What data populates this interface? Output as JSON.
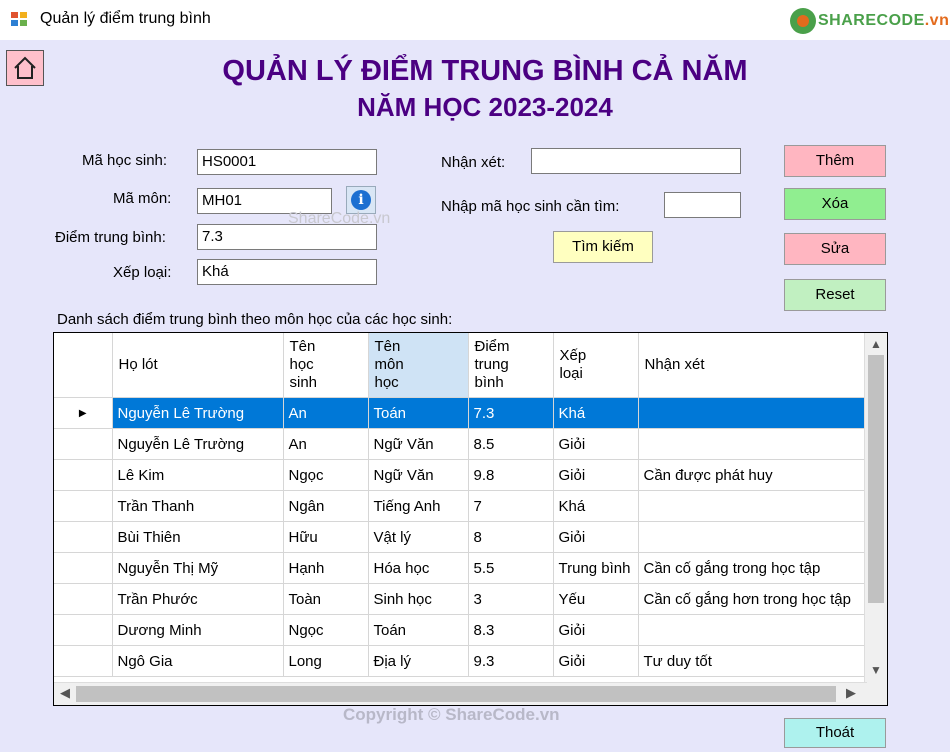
{
  "window": {
    "title": "Quản lý điểm trung bình",
    "brand": "SHARECODE",
    "brand_suffix": ".vn"
  },
  "header": {
    "title": "QUẢN LÝ ĐIỂM TRUNG BÌNH CẢ NĂM",
    "subtitle": "NĂM HỌC 2023-2024"
  },
  "form": {
    "ma_hoc_sinh_label": "Mã học sinh:",
    "ma_hoc_sinh_value": "HS0001",
    "ma_mon_label": "Mã môn:",
    "ma_mon_value": "MH01",
    "diem_tb_label": "Điểm trung bình:",
    "diem_tb_value": "7.3",
    "xep_loai_label": "Xếp loại:",
    "xep_loai_value": "Khá",
    "nhan_xet_label": "Nhận xét:",
    "nhan_xet_value": "",
    "search_label": "Nhập mã học sinh cần tìm:",
    "search_value": ""
  },
  "buttons": {
    "search": "Tìm kiếm",
    "add": "Thêm",
    "delete": "Xóa",
    "edit": "Sửa",
    "reset": "Reset",
    "exit": "Thoát"
  },
  "colors": {
    "add": "#ffb6c1",
    "delete": "#90ee90",
    "edit": "#ffb6c1",
    "reset": "#c1f0c1",
    "search": "#ffffc0",
    "exit": "#aef2ee",
    "title": "#4b0082",
    "selected_row": "#0078d7"
  },
  "list_label": "Danh sách điểm trung bình theo môn học của các học sinh:",
  "table": {
    "columns": [
      [
        "Họ lót"
      ],
      [
        "Tên",
        "học",
        "sinh"
      ],
      [
        "Tên",
        "môn",
        "học"
      ],
      [
        "Điểm",
        "trung",
        "bình"
      ],
      [
        "Xếp",
        "loại"
      ],
      [
        "Nhận xét"
      ]
    ],
    "selected_column": 2,
    "selected_row": 0,
    "rows": [
      [
        "Nguyễn Lê Trường",
        "An",
        "Toán",
        "7.3",
        "Khá",
        ""
      ],
      [
        "Nguyễn Lê Trường",
        "An",
        "Ngữ Văn",
        "8.5",
        "Giỏi",
        ""
      ],
      [
        "Lê Kim",
        "Ngọc",
        "Ngữ Văn",
        "9.8",
        "Giỏi",
        "Cần được phát huy"
      ],
      [
        "Trần Thanh",
        "Ngân",
        "Tiếng Anh",
        "7",
        "Khá",
        ""
      ],
      [
        "Bùi Thiên",
        "Hữu",
        "Vật lý",
        "8",
        "Giỏi",
        ""
      ],
      [
        "Nguyễn Thị Mỹ",
        "Hạnh",
        "Hóa học",
        "5.5",
        "Trung bình",
        "Cần cố gắng trong học tập"
      ],
      [
        "Trần Phước",
        "Toàn",
        "Sinh học",
        "3",
        "Yếu",
        "Cần cố gắng hơn trong học tập"
      ],
      [
        "Dương Minh",
        "Ngọc",
        "Toán",
        "8.3",
        "Giỏi",
        ""
      ],
      [
        "Ngô Gia",
        "Long",
        "Địa lý",
        "9.3",
        "Giỏi",
        "Tư duy tốt"
      ]
    ]
  },
  "watermarks": {
    "center": "ShareCode.vn",
    "bottom": "Copyright © ShareCode.vn"
  }
}
